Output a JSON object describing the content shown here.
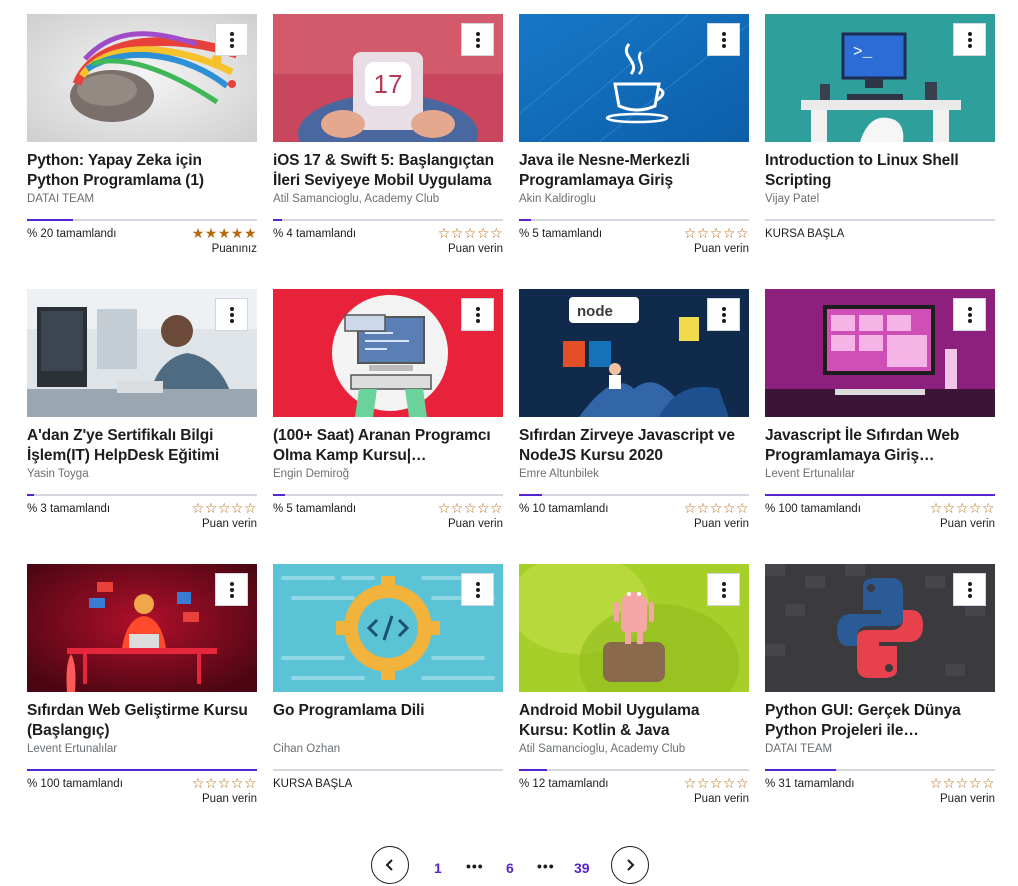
{
  "courses": [
    {
      "title": "Python: Yapay Zeka için Python Programlama (1)",
      "author": "DATAI TEAM",
      "progress_pct": 20,
      "progress_label": "% 20 tamamlandı",
      "rating": 5,
      "rating_label": "Puanınız",
      "thumbnail": "brain-colorful-splash",
      "menu_icon": "more-vertical-icon"
    },
    {
      "title": "iOS 17 & Swift 5: Başlangıçtan İleri Seviyeye Mobil Uygulama",
      "author": "Atil Samancioglu, Academy Club",
      "progress_pct": 4,
      "progress_label": "% 4 tamamlandı",
      "rating": 0,
      "rating_label": "Puan verin",
      "thumbnail": "ios17-phone",
      "menu_icon": "more-vertical-icon"
    },
    {
      "title": "Java ile Nesne-Merkezli Programlamaya Giriş",
      "author": "Akin Kaldiroglu",
      "progress_pct": 5,
      "progress_label": "% 5 tamamlandı",
      "rating": 0,
      "rating_label": "Puan verin",
      "thumbnail": "java-cup",
      "menu_icon": "more-vertical-icon"
    },
    {
      "title": "Introduction to Linux Shell Scripting",
      "author": "Vijay Patel",
      "progress_pct": 0,
      "start_label": "KURSA BAŞLA",
      "thumbnail": "linux-desk",
      "menu_icon": "more-vertical-icon"
    },
    {
      "title": "A'dan Z'ye Sertifikalı Bilgi İşlem(IT) HelpDesk Eğitimi",
      "author": "Yasin Toyga",
      "progress_pct": 3,
      "progress_label": "% 3 tamamlandı",
      "rating": 0,
      "rating_label": "Puan verin",
      "thumbnail": "helpdesk-office",
      "menu_icon": "more-vertical-icon"
    },
    {
      "title": "(100+ Saat) Aranan Programcı Olma Kamp Kursu|…",
      "author": "Engin Demiroğ",
      "progress_pct": 5,
      "progress_label": "% 5 tamamlandı",
      "rating": 0,
      "rating_label": "Puan verin",
      "thumbnail": "programmer-red",
      "menu_icon": "more-vertical-icon"
    },
    {
      "title": "Sıfırdan Zirveye Javascript ve NodeJS Kursu 2020",
      "author": "Emre Altunbilek",
      "progress_pct": 10,
      "progress_label": "% 10 tamamlandı",
      "rating": 0,
      "rating_label": "Puan verin",
      "thumbnail": "nodejs-navy",
      "thumb_text": "node",
      "menu_icon": "more-vertical-icon"
    },
    {
      "title": "Javascript İle Sıfırdan Web Programlamaya Giriş…",
      "author": "Levent Ertunalılar",
      "progress_pct": 100,
      "progress_label": "% 100 tamamlandı",
      "rating": 0,
      "rating_label": "Puan verin",
      "thumbnail": "purple-desk",
      "menu_icon": "more-vertical-icon"
    },
    {
      "title": "Sıfırdan Web Geliştirme Kursu (Başlangıç)",
      "author": "Levent Ertunalılar",
      "progress_pct": 100,
      "progress_label": "% 100 tamamlandı",
      "rating": 0,
      "rating_label": "Puan verin",
      "thumbnail": "webdev-dark-red",
      "menu_icon": "more-vertical-icon"
    },
    {
      "title": "Go Programlama Dili",
      "author": "Cihan Özhan",
      "progress_pct": 0,
      "start_label": "KURSA BAŞLA",
      "thumbnail": "go-gear",
      "menu_icon": "more-vertical-icon"
    },
    {
      "title": "Android Mobil Uygulama Kursu: Kotlin & Java",
      "author": "Atil Samancioglu, Academy Club",
      "progress_pct": 12,
      "progress_label": "% 12 tamamlandı",
      "rating": 0,
      "rating_label": "Puan verin",
      "thumbnail": "android-green",
      "menu_icon": "more-vertical-icon"
    },
    {
      "title": "Python GUI: Gerçek Dünya Python Projeleri ile…",
      "author": "DATAI TEAM",
      "progress_pct": 31,
      "progress_label": "% 31 tamamlandı",
      "rating": 0,
      "rating_label": "Puan verin",
      "thumbnail": "python-logo",
      "menu_icon": "more-vertical-icon"
    }
  ],
  "pagination": {
    "first": "1",
    "current": "6",
    "last": "39",
    "ellipsis": "•••"
  },
  "colors": {
    "accent": "#5624d0",
    "star": "#b4690e",
    "track": "#d1d7dc"
  }
}
